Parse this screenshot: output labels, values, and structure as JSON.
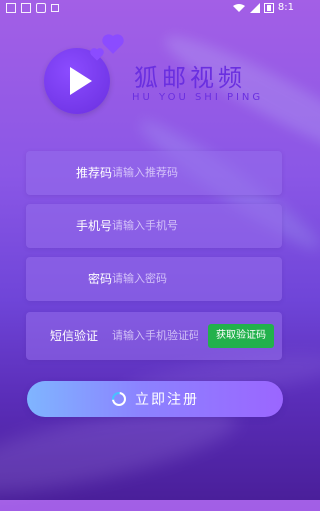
{
  "status_bar": {
    "time": "8:1",
    "icons": [
      "notification-icon",
      "bag-icon",
      "lock-icon",
      "wifi-icon",
      "signal-icon",
      "battery-icon"
    ]
  },
  "logo": {
    "title": "狐邮视频",
    "subtitle": "HU YOU SHI PING",
    "brand_color": "#6a2fe0"
  },
  "form": {
    "fields": [
      {
        "label": "推荐码",
        "placeholder": "请输入推荐码",
        "value": ""
      },
      {
        "label": "手机号",
        "placeholder": "请输入手机号",
        "value": ""
      },
      {
        "label": "密码",
        "placeholder": "请输入密码",
        "value": ""
      },
      {
        "label": "短信验证",
        "placeholder": "请输入手机验证码",
        "value": ""
      }
    ],
    "get_code_label": "获取验证码",
    "get_code_color": "#22b14c"
  },
  "register": {
    "label": "立即注册",
    "icon": "loading-arc-icon"
  }
}
